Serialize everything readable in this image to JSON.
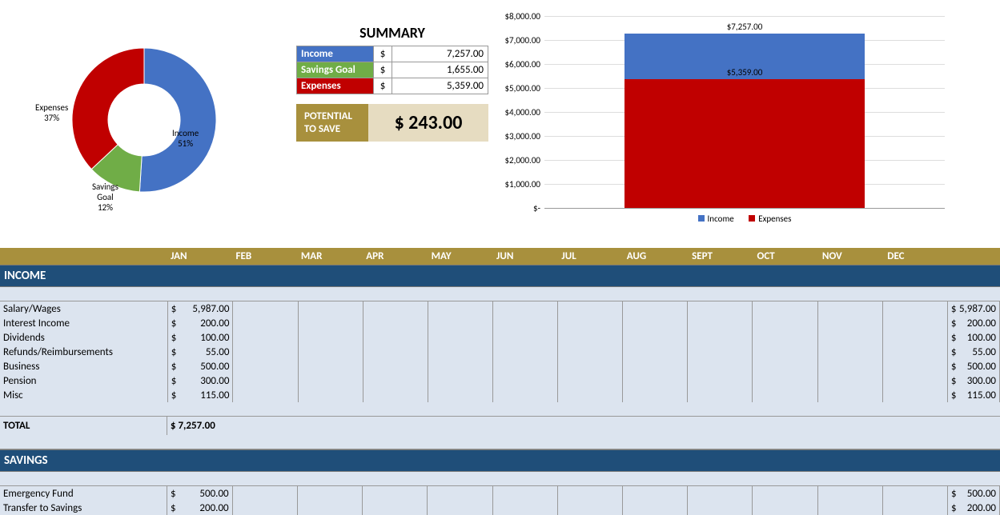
{
  "summary": {
    "title": "SUMMARY",
    "rows": [
      {
        "label": "Income",
        "value": "7,257.00",
        "color": "#4472c4"
      },
      {
        "label": "Savings Goal",
        "value": "1,655.00",
        "color": "#70ad47"
      },
      {
        "label": "Expenses",
        "value": "5,359.00",
        "color": "#c00000"
      }
    ],
    "potential_label": "POTENTIAL TO SAVE",
    "potential_value": "$   243.00"
  },
  "months": [
    "JAN",
    "FEB",
    "MAR",
    "APR",
    "MAY",
    "JUN",
    "JUL",
    "AUG",
    "SEPT",
    "OCT",
    "NOV",
    "DEC"
  ],
  "income": {
    "header": "INCOME",
    "rows": [
      {
        "label": "Salary/Wages",
        "jan": "5,987.00",
        "total": "5,987.00"
      },
      {
        "label": "Interest Income",
        "jan": "200.00",
        "total": "200.00"
      },
      {
        "label": "Dividends",
        "jan": "100.00",
        "total": "100.00"
      },
      {
        "label": "Refunds/Reimbursements",
        "jan": "55.00",
        "total": "55.00"
      },
      {
        "label": "Business",
        "jan": "500.00",
        "total": "500.00"
      },
      {
        "label": "Pension",
        "jan": "300.00",
        "total": "300.00"
      },
      {
        "label": "Misc",
        "jan": "115.00",
        "total": "115.00"
      }
    ],
    "total_label": "TOTAL",
    "total_value": "$  7,257.00"
  },
  "savings": {
    "header": "SAVINGS",
    "rows": [
      {
        "label": "Emergency Fund",
        "jan": "500.00",
        "total": "500.00"
      },
      {
        "label": "Transfer to Savings",
        "jan": "200.00",
        "total": "200.00"
      }
    ]
  },
  "chart_data": [
    {
      "type": "pie",
      "title": "",
      "series": [
        {
          "name": "Income",
          "value": 51,
          "color": "#4472c4"
        },
        {
          "name": "Savings Goal",
          "value": 12,
          "color": "#70ad47"
        },
        {
          "name": "Expenses",
          "value": 37,
          "color": "#c00000"
        }
      ],
      "labels": [
        "Income 51%",
        "Savings Goal 12%",
        "Expenses 37%"
      ]
    },
    {
      "type": "bar",
      "categories": [
        ""
      ],
      "series": [
        {
          "name": "Income",
          "values": [
            7257
          ],
          "color": "#4472c4"
        },
        {
          "name": "Expenses",
          "values": [
            5359
          ],
          "color": "#c00000"
        }
      ],
      "ylim": [
        0,
        8000
      ],
      "yticks": [
        "$-",
        "$1,000.00",
        "$2,000.00",
        "$3,000.00",
        "$4,000.00",
        "$5,000.00",
        "$6,000.00",
        "$7,000.00",
        "$8,000.00"
      ],
      "data_labels": [
        "$7,257.00",
        "$5,359.00"
      ],
      "legend": [
        "Income",
        "Expenses"
      ]
    }
  ]
}
